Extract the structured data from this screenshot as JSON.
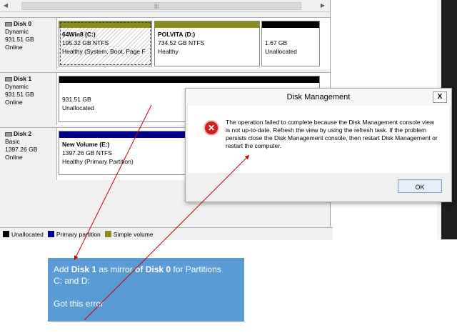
{
  "scrollbar": {
    "left_arrow": "◀",
    "right_arrow": "▶",
    "grip": "|||"
  },
  "disks": [
    {
      "name": "Disk 0",
      "type": "Dynamic",
      "size": "931.51 GB",
      "status": "Online",
      "partitions": [
        {
          "title": "64Win8  (C:)",
          "size": "195.32 GB NTFS",
          "status": "Healthy (System, Boot, Page F",
          "bar_color": "#8b8b1e"
        },
        {
          "title": "POLVITA  (D:)",
          "size": "734.52 GB NTFS",
          "status": "Healthy",
          "bar_color": "#8b8b1e"
        },
        {
          "title": "",
          "size": "1.67 GB",
          "status": "Unallocated",
          "bar_color": "#000000"
        }
      ]
    },
    {
      "name": "Disk 1",
      "type": "Dynamic",
      "size": "931.51 GB",
      "status": "Online",
      "partitions": [
        {
          "title": "",
          "size": "931.51 GB",
          "status": "Unallocated",
          "bar_color": "#000000"
        }
      ]
    },
    {
      "name": "Disk 2",
      "type": "Basic",
      "size": "1397.26 GB",
      "status": "Online",
      "partitions": [
        {
          "title": "New Volume  (E:)",
          "size": "1397.26 GB NTFS",
          "status": "Healthy (Primary Partition)",
          "bar_color": "#00008b"
        }
      ]
    }
  ],
  "legend": [
    {
      "label": "Unallocated",
      "color": "#000000"
    },
    {
      "label": "Primary partition",
      "color": "#00008b"
    },
    {
      "label": "Simple volume",
      "color": "#8b8b1e"
    }
  ],
  "dialog": {
    "title": "Disk Management",
    "close": "X",
    "icon": "error-icon",
    "icon_glyph": "✕",
    "message": "The operation failed to complete because the Disk Management console view is not up-to-date.  Refresh the view by using the refresh task. If the problem persists close the Disk Management console, then restart Disk Management or restart the computer.",
    "ok": "OK"
  },
  "annotation": {
    "line1_a": "Add ",
    "line1_b": "Disk 1",
    "line1_c": " as mirror ",
    "line1_d": "of Disk 0",
    "line1_e": " for Partitions",
    "line2": "C: and D:",
    "line3": "Got this error",
    "arrow_color": "#cc0000"
  }
}
